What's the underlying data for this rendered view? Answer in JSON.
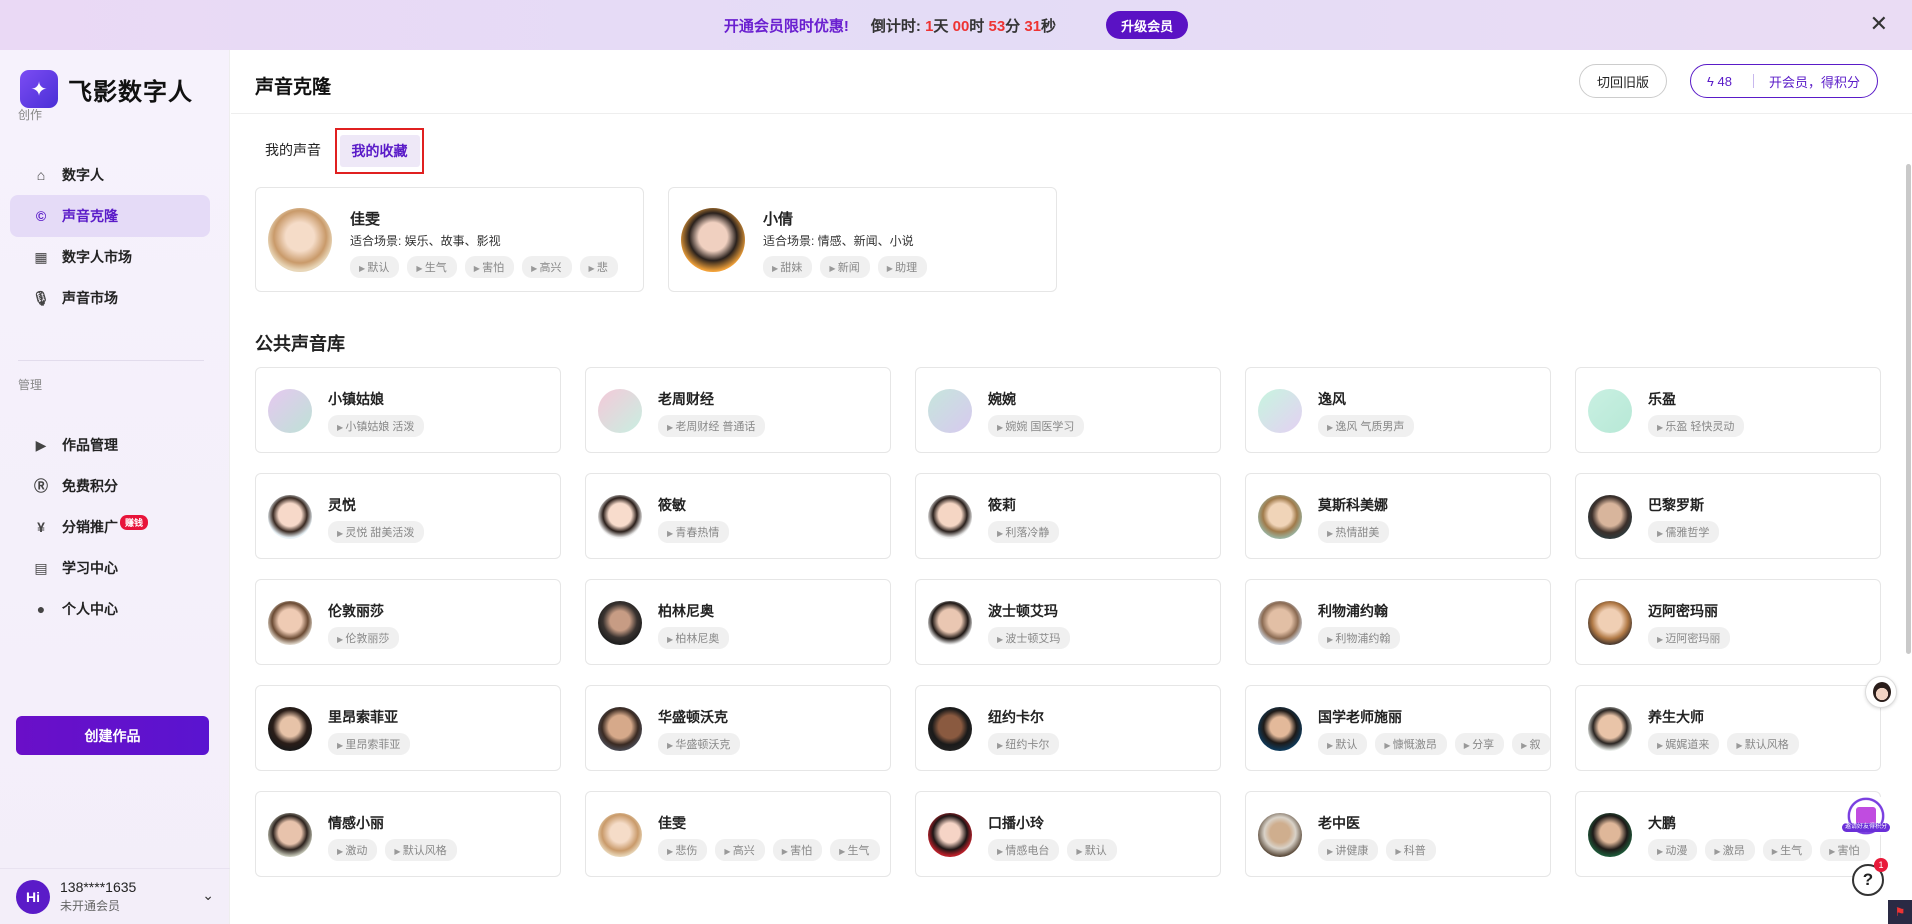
{
  "promo": {
    "title": "开通会员限时优惠!",
    "countdown_label": "倒计时:",
    "days": "1",
    "days_unit": "天",
    "hours": "00",
    "hours_unit": "时",
    "minutes": "53",
    "minutes_unit": "分",
    "seconds": "31",
    "seconds_unit": "秒",
    "upgrade_label": "升级会员"
  },
  "sidebar": {
    "brand": "飞影数字人",
    "section_create": "创作",
    "create_items": [
      {
        "label": "数字人",
        "icon": "home-icon"
      },
      {
        "label": "声音克隆",
        "icon": "clone-icon",
        "active": true
      },
      {
        "label": "数字人市场",
        "icon": "grid-icon"
      },
      {
        "label": "声音市场",
        "icon": "microphone-icon"
      }
    ],
    "section_manage": "管理",
    "manage_items": [
      {
        "label": "作品管理",
        "icon": "video-icon"
      },
      {
        "label": "免费积分",
        "icon": "points-icon"
      },
      {
        "label": "分销推广",
        "icon": "yen-icon",
        "badge": "赚钱"
      },
      {
        "label": "学习中心",
        "icon": "book-icon"
      },
      {
        "label": "个人中心",
        "icon": "person-icon"
      }
    ],
    "create_button": "创建作品",
    "user": {
      "avatar": "Hi",
      "phone": "138****1635",
      "status": "未开通会员"
    }
  },
  "header": {
    "title": "声音克隆",
    "old_version": "切回旧版",
    "points_value": "48",
    "points_cta": "开会员，得积分"
  },
  "tabs": [
    "我的声音",
    "我的收藏"
  ],
  "favorites": [
    {
      "name": "佳雯",
      "scene": "适合场景: 娱乐、故事、影视",
      "tags": [
        "默认",
        "生气",
        "害怕",
        "高兴",
        "悲"
      ]
    },
    {
      "name": "小倩",
      "scene": "适合场景: 情感、新闻、小说",
      "tags": [
        "甜妹",
        "新闻",
        "助理"
      ]
    }
  ],
  "library": {
    "title": "公共声音库",
    "voices": [
      {
        "name": "小镇姑娘",
        "tags": [
          "小镇姑娘 活泼"
        ]
      },
      {
        "name": "老周财经",
        "tags": [
          "老周财经 普通话"
        ]
      },
      {
        "name": "婉婉",
        "tags": [
          "婉婉 国医学习"
        ]
      },
      {
        "name": "逸风",
        "tags": [
          "逸风 气质男声"
        ]
      },
      {
        "name": "乐盈",
        "tags": [
          "乐盈 轻快灵动"
        ]
      },
      {
        "name": "灵悦",
        "tags": [
          "灵悦 甜美活泼"
        ]
      },
      {
        "name": "筱敏",
        "tags": [
          "青春热情"
        ]
      },
      {
        "name": "筱莉",
        "tags": [
          "利落冷静"
        ]
      },
      {
        "name": "莫斯科美娜",
        "tags": [
          "热情甜美"
        ]
      },
      {
        "name": "巴黎罗斯",
        "tags": [
          "儒雅哲学"
        ]
      },
      {
        "name": "伦敦丽莎",
        "tags": [
          "伦敦丽莎"
        ]
      },
      {
        "name": "柏林尼奥",
        "tags": [
          "柏林尼奥"
        ]
      },
      {
        "name": "波士顿艾玛",
        "tags": [
          "波士顿艾玛"
        ]
      },
      {
        "name": "利物浦约翰",
        "tags": [
          "利物浦约翰"
        ]
      },
      {
        "name": "迈阿密玛丽",
        "tags": [
          "迈阿密玛丽"
        ]
      },
      {
        "name": "里昂索菲亚",
        "tags": [
          "里昂索菲亚"
        ]
      },
      {
        "name": "华盛顿沃克",
        "tags": [
          "华盛顿沃克"
        ]
      },
      {
        "name": "纽约卡尔",
        "tags": [
          "纽约卡尔"
        ]
      },
      {
        "name": "国学老师施丽",
        "tags": [
          "默认",
          "慷慨激昂",
          "分享",
          "叙"
        ]
      },
      {
        "name": "养生大师",
        "tags": [
          "娓娓道来",
          "默认风格"
        ]
      },
      {
        "name": "情感小丽",
        "tags": [
          "激动",
          "默认风格"
        ]
      },
      {
        "name": "佳雯",
        "tags": [
          "悲伤",
          "高兴",
          "害怕",
          "生气"
        ]
      },
      {
        "name": "口播小玲",
        "tags": [
          "情感电台",
          "默认"
        ]
      },
      {
        "name": "老中医",
        "tags": [
          "讲健康",
          "科普"
        ]
      },
      {
        "name": "大鹏",
        "tags": [
          "动漫",
          "激昂",
          "生气",
          "害怕"
        ]
      }
    ]
  },
  "floating": {
    "gift_label": "邀请好友得积分",
    "help": "?",
    "help_count": "1"
  }
}
